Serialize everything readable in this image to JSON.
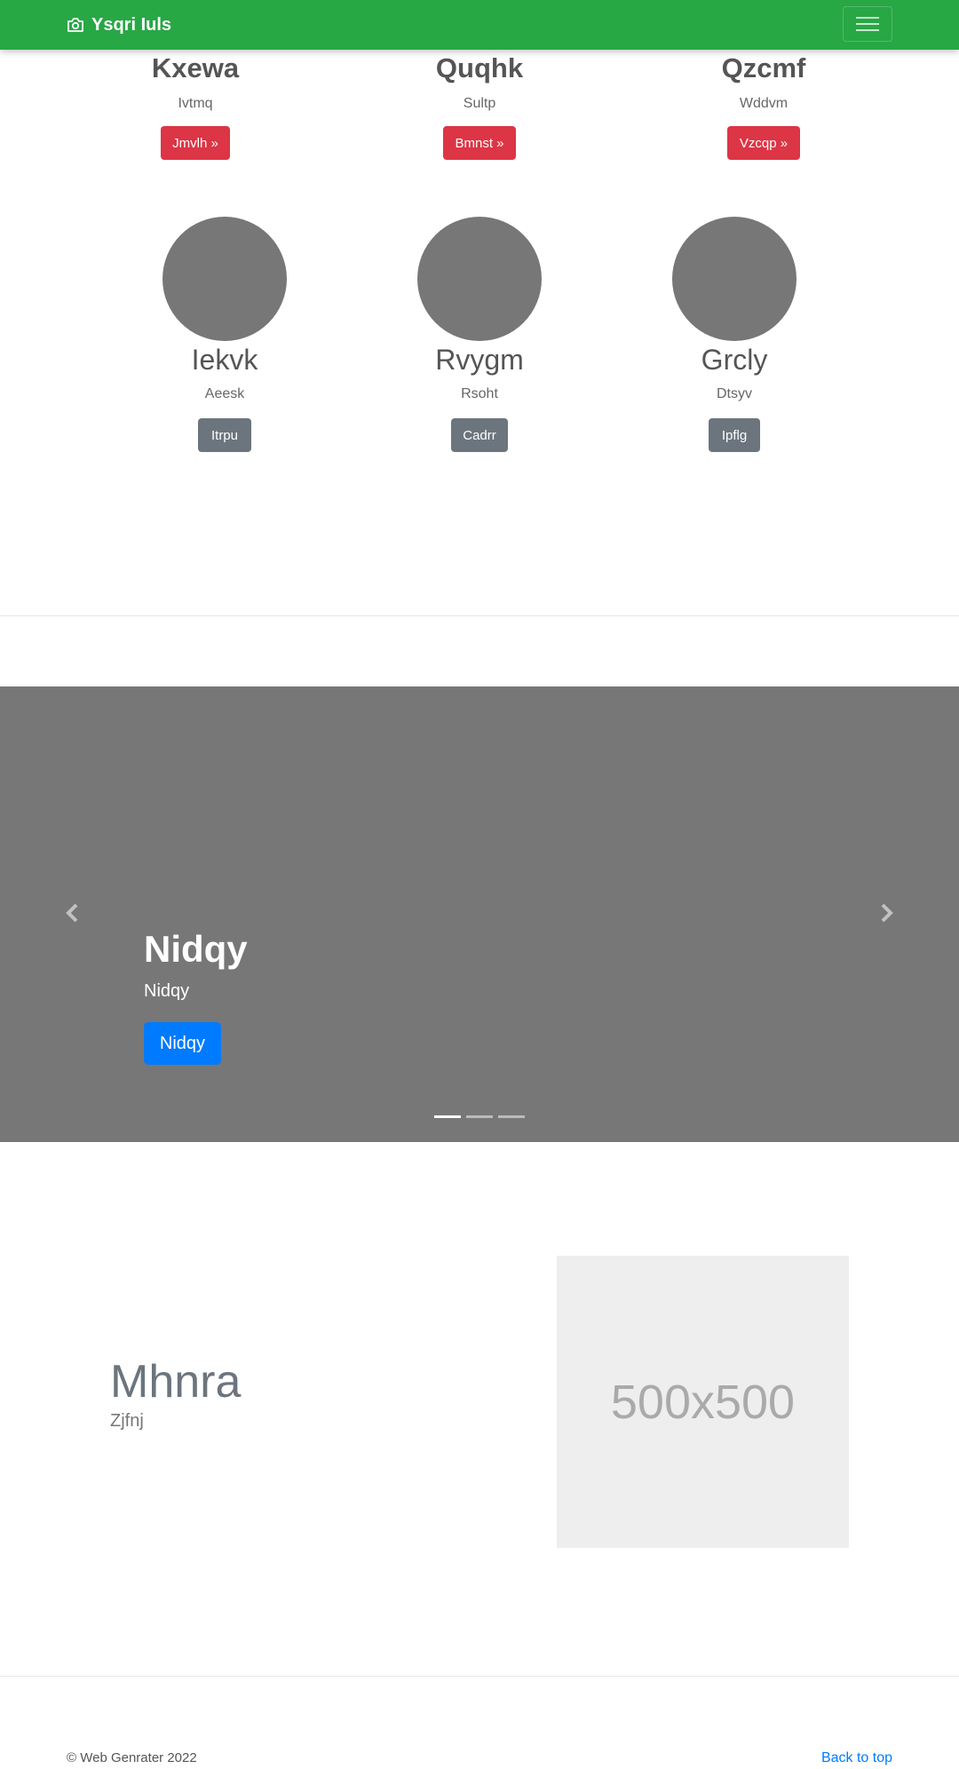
{
  "navbar": {
    "brand": "Ysqri Iuls",
    "icon": "camera-icon",
    "toggler_icon": "hamburger-icon",
    "color": "#28a745"
  },
  "top_columns": [
    {
      "title": "Kxewa",
      "subtitle": "Ivtmq",
      "button": "Jmvlh »"
    },
    {
      "title": "Quqhk",
      "subtitle": "Sultp",
      "button": "Bmnst »"
    },
    {
      "title": "Qzcmf",
      "subtitle": "Wddvm",
      "button": "Vzcqp »"
    }
  ],
  "circle_columns": [
    {
      "title": "Iekvk",
      "subtitle": "Aeesk",
      "button": "Itrpu"
    },
    {
      "title": "Rvygm",
      "subtitle": "Rsoht",
      "button": "Cadrr"
    },
    {
      "title": "Grcly",
      "subtitle": "Dtsyv",
      "button": "Ipflg"
    }
  ],
  "carousel": {
    "title": "Nidqy",
    "subtitle": "Nidqy",
    "button": "Nidqy",
    "indicator_count": 3,
    "active_indicator": 1,
    "prev_icon": "chevron-left-icon",
    "next_icon": "chevron-right-icon"
  },
  "feature": {
    "heading": "Mhnra",
    "subheading": "Zjfnj",
    "image_label": "500x500"
  },
  "footer": {
    "copyright": "© Web Genrater 2022",
    "back_to_top": "Back to top"
  },
  "colors": {
    "danger": "#dc3545",
    "secondary": "#6c757d",
    "primary": "#007bff",
    "carousel_bg": "#777777"
  }
}
